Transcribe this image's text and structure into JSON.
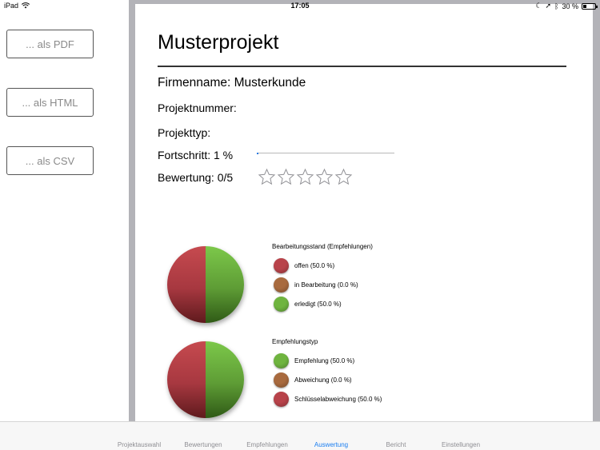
{
  "status_bar": {
    "device": "iPad",
    "time": "17:05",
    "battery": "30 %",
    "battery_level": 0.3
  },
  "export": {
    "pdf_label": "... als PDF",
    "html_label": "... als HTML",
    "csv_label": "... als CSV"
  },
  "report": {
    "title": "Musterprojekt",
    "company": "Firmenname: Musterkunde",
    "project_number": "Projektnummer:",
    "project_type": "Projekttyp:",
    "progress_text": "Fortschritt: 1 %",
    "progress_value": 0.01,
    "rating_text": "Bewertung: 0/5",
    "rating_value": 0,
    "rating_max": 5
  },
  "charts": {
    "status_chart": {
      "title": "Bearbeitungsstand (Empfehlungen)",
      "items": [
        {
          "label": "offen (50.0 %)",
          "color": "#b8434a"
        },
        {
          "label": "in Bearbeitung (0.0 %)",
          "color": "#a86a3e"
        },
        {
          "label": "erledigt (50.0 %)",
          "color": "#6fb43f"
        }
      ]
    },
    "type_chart": {
      "title": "Empfehlungstyp",
      "items": [
        {
          "label": "Empfehlung (50.0 %)",
          "color": "#6fb43f"
        },
        {
          "label": "Abweichung (0.0 %)",
          "color": "#a86a3e"
        },
        {
          "label": "Schlüsselabweichung (50.0 %)",
          "color": "#b8434a"
        }
      ]
    }
  },
  "tabs": [
    {
      "label": "Projektauswahl"
    },
    {
      "label": "Bewertungen"
    },
    {
      "label": "Empfehlungen"
    },
    {
      "label": "Auswertung",
      "active": true
    },
    {
      "label": "Bericht"
    },
    {
      "label": "Einstellungen"
    }
  ],
  "colors": {
    "accent": "#1a7ef0",
    "red": "#b8434a",
    "green": "#6fb43f",
    "brown": "#a86a3e"
  }
}
